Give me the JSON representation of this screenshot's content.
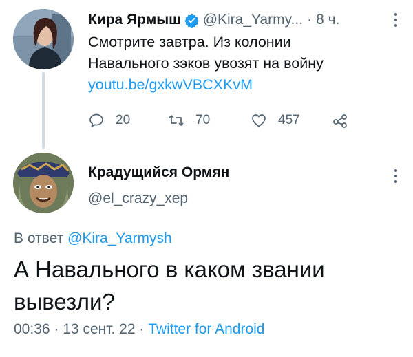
{
  "tweet1": {
    "author_name": "Кира Ярмыш",
    "handle": "@Kira_Yarmy...",
    "separator": "·",
    "time": "8 ч.",
    "text_lines": [
      "Смотрите завтра. Из колонии",
      "Навального зэков увозят на войну"
    ],
    "link": "youtu.be/gxkwVBCXKvM",
    "stats": {
      "replies": "20",
      "retweets": "70",
      "likes": "457"
    }
  },
  "tweet2": {
    "author_name": "Крадущийся Ормян",
    "handle": "@el_crazy_xep",
    "reply_prefix": "В ответ",
    "reply_mention": "@Kira_Yarmysh",
    "text_lines": [
      "А Навального в каком звании",
      "вывезли?"
    ],
    "time": "00:36",
    "separator": "·",
    "date": "13 сент. 22",
    "source": "Twitter for Android"
  },
  "icons": [
    "verified-icon",
    "more-icon",
    "reply-icon",
    "retweet-icon",
    "like-icon",
    "share-icon"
  ],
  "colors": {
    "link": "#1d9bf0",
    "muted": "#536471",
    "text": "#0f1419",
    "thread_line": "#cfd9de"
  }
}
